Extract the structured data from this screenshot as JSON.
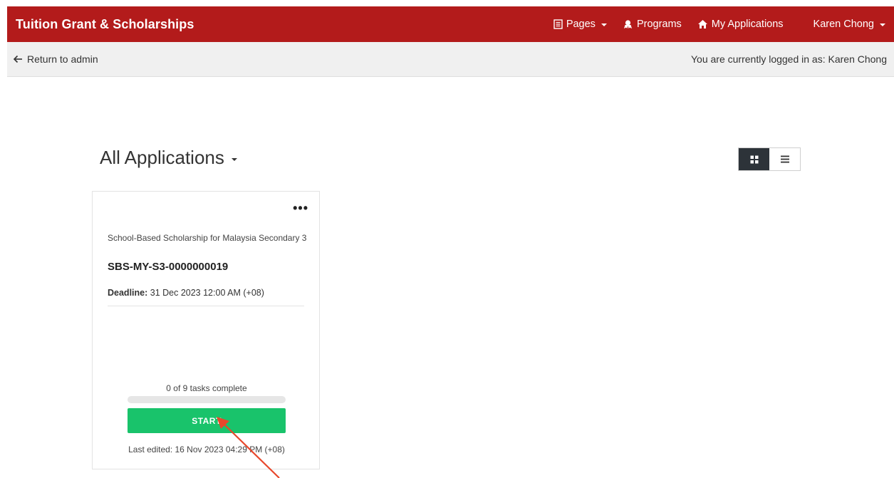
{
  "navbar": {
    "brand": "Tuition Grant & Scholarships",
    "pages_label": "Pages",
    "programs_label": "Programs",
    "my_applications_label": "My Applications",
    "user_label": "Karen Chong",
    "icons": [
      "pages-icon",
      "programs-icon",
      "home-icon"
    ],
    "bg_color": "#b31b1b"
  },
  "adminbar": {
    "return_label": "Return to admin",
    "logged_in_text": "You are currently logged in as: Karen Chong"
  },
  "main": {
    "heading": "All Applications",
    "view_toggle": {
      "options": [
        "grid",
        "list"
      ],
      "selected": "grid"
    }
  },
  "card": {
    "menu_label": "•••",
    "program_name": "School-Based Scholarship for Malaysia Secondary 3",
    "application_id": "SBS-MY-S3-0000000019",
    "deadline_label": "Deadline:",
    "deadline_value": "31 Dec 2023 12:00 AM (+08)",
    "tasks_text": "0 of 9 tasks complete",
    "tasks_completed": 0,
    "tasks_total": 9,
    "start_label": "START",
    "last_edited": "Last edited: 16 Nov 2023 04:29 PM (+08)",
    "accent_color": "#19c36b"
  },
  "annotation": {
    "arrow_color": "#e8472b"
  }
}
